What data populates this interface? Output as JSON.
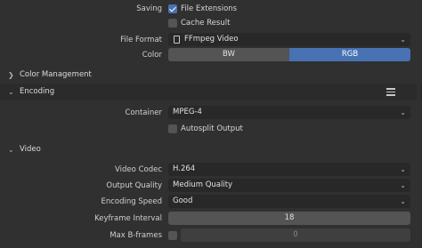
{
  "output": {
    "saving_label": "Saving",
    "file_extensions_label": "File Extensions",
    "file_extensions_checked": true,
    "cache_result_label": "Cache Result",
    "cache_result_checked": false,
    "file_format_label": "File Format",
    "file_format_value": "FFmpeg Video",
    "color_label": "Color",
    "color_options": [
      "BW",
      "RGB"
    ],
    "color_selected": "RGB"
  },
  "color_management": {
    "title": "Color Management",
    "expanded": false
  },
  "encoding": {
    "title": "Encoding",
    "expanded": true,
    "container_label": "Container",
    "container_value": "MPEG-4",
    "autosplit_label": "Autosplit Output",
    "autosplit_checked": false
  },
  "video": {
    "title": "Video",
    "expanded": true,
    "codec_label": "Video Codec",
    "codec_value": "H.264",
    "quality_label": "Output Quality",
    "quality_value": "Medium Quality",
    "speed_label": "Encoding Speed",
    "speed_value": "Good",
    "keyframe_label": "Keyframe Interval",
    "keyframe_value": "18",
    "bframes_label": "Max B-frames",
    "bframes_checked": false,
    "bframes_value": "0"
  },
  "icons": {
    "expand": "chevron-down-icon",
    "collapse": "chevron-right-icon",
    "dropdown": "chevron-down-icon",
    "file": "file-video-icon",
    "presets": "list-icon"
  },
  "colors": {
    "accent": "#4772b3",
    "background": "#303030",
    "field": "#282828"
  }
}
